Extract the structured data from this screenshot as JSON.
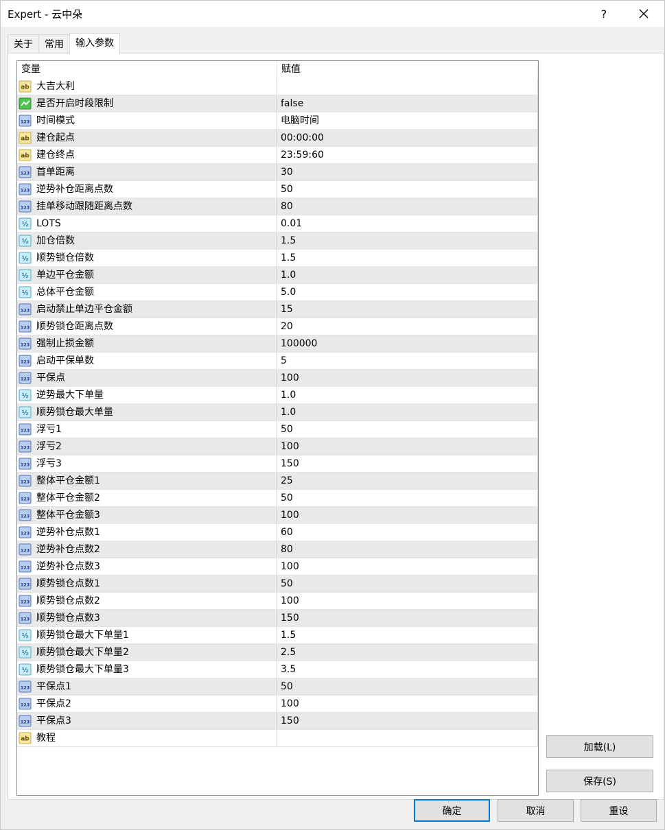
{
  "window": {
    "title": "Expert - 云中朵",
    "help_label": "?"
  },
  "tabs": [
    {
      "label": "关于"
    },
    {
      "label": "常用"
    },
    {
      "label": "输入参数"
    }
  ],
  "table": {
    "columns": [
      "变量",
      "赋值"
    ],
    "rows": [
      {
        "type": "string",
        "name": "大吉大利",
        "value": ""
      },
      {
        "type": "bool",
        "name": "是否开启时段限制",
        "value": "false"
      },
      {
        "type": "int",
        "name": "时间模式",
        "value": "电脑时间"
      },
      {
        "type": "string",
        "name": "建仓起点",
        "value": "00:00:00"
      },
      {
        "type": "string",
        "name": "建仓终点",
        "value": "23:59:60"
      },
      {
        "type": "int",
        "name": "首单距离",
        "value": "30"
      },
      {
        "type": "int",
        "name": "逆势补仓距离点数",
        "value": "50"
      },
      {
        "type": "int",
        "name": "挂单移动跟随距离点数",
        "value": "80"
      },
      {
        "type": "double",
        "name": "LOTS",
        "value": "0.01"
      },
      {
        "type": "double",
        "name": "加仓倍数",
        "value": "1.5"
      },
      {
        "type": "double",
        "name": "顺势锁仓倍数",
        "value": "1.5"
      },
      {
        "type": "double",
        "name": "单边平仓金额",
        "value": "1.0"
      },
      {
        "type": "double",
        "name": "总体平仓金额",
        "value": "5.0"
      },
      {
        "type": "int",
        "name": "启动禁止单边平仓金额",
        "value": "15"
      },
      {
        "type": "int",
        "name": "顺势锁仓距离点数",
        "value": "20"
      },
      {
        "type": "int",
        "name": "强制止损金额",
        "value": "100000"
      },
      {
        "type": "int",
        "name": "启动平保单数",
        "value": "5"
      },
      {
        "type": "int",
        "name": "平保点",
        "value": "100"
      },
      {
        "type": "double",
        "name": "逆势最大下单量",
        "value": "1.0"
      },
      {
        "type": "double",
        "name": "顺势锁仓最大单量",
        "value": "1.0"
      },
      {
        "type": "int",
        "name": "浮亏1",
        "value": "50"
      },
      {
        "type": "int",
        "name": "浮亏2",
        "value": "100"
      },
      {
        "type": "int",
        "name": "浮亏3",
        "value": "150"
      },
      {
        "type": "int",
        "name": "整体平仓金额1",
        "value": "25"
      },
      {
        "type": "int",
        "name": "整体平仓金额2",
        "value": "50"
      },
      {
        "type": "int",
        "name": "整体平仓金额3",
        "value": "100"
      },
      {
        "type": "int",
        "name": "逆势补仓点数1",
        "value": "60"
      },
      {
        "type": "int",
        "name": "逆势补仓点数2",
        "value": "80"
      },
      {
        "type": "int",
        "name": "逆势补仓点数3",
        "value": "100"
      },
      {
        "type": "int",
        "name": "顺势锁仓点数1",
        "value": "50"
      },
      {
        "type": "int",
        "name": "顺势锁仓点数2",
        "value": "100"
      },
      {
        "type": "int",
        "name": "顺势锁仓点数3",
        "value": "150"
      },
      {
        "type": "double",
        "name": "顺势锁仓最大下单量1",
        "value": "1.5"
      },
      {
        "type": "double",
        "name": "顺势锁仓最大下单量2",
        "value": "2.5"
      },
      {
        "type": "double",
        "name": "顺势锁仓最大下单量3",
        "value": "3.5"
      },
      {
        "type": "int",
        "name": "平保点1",
        "value": "50"
      },
      {
        "type": "int",
        "name": "平保点2",
        "value": "100"
      },
      {
        "type": "int",
        "name": "平保点3",
        "value": "150"
      },
      {
        "type": "string",
        "name": "教程",
        "value": ""
      }
    ]
  },
  "buttons": {
    "load": "加载(L)",
    "save": "保存(S)",
    "ok": "确定",
    "cancel": "取消",
    "reset": "重设"
  },
  "icon_labels": {
    "string": "ab",
    "int": "123",
    "double": "½"
  }
}
